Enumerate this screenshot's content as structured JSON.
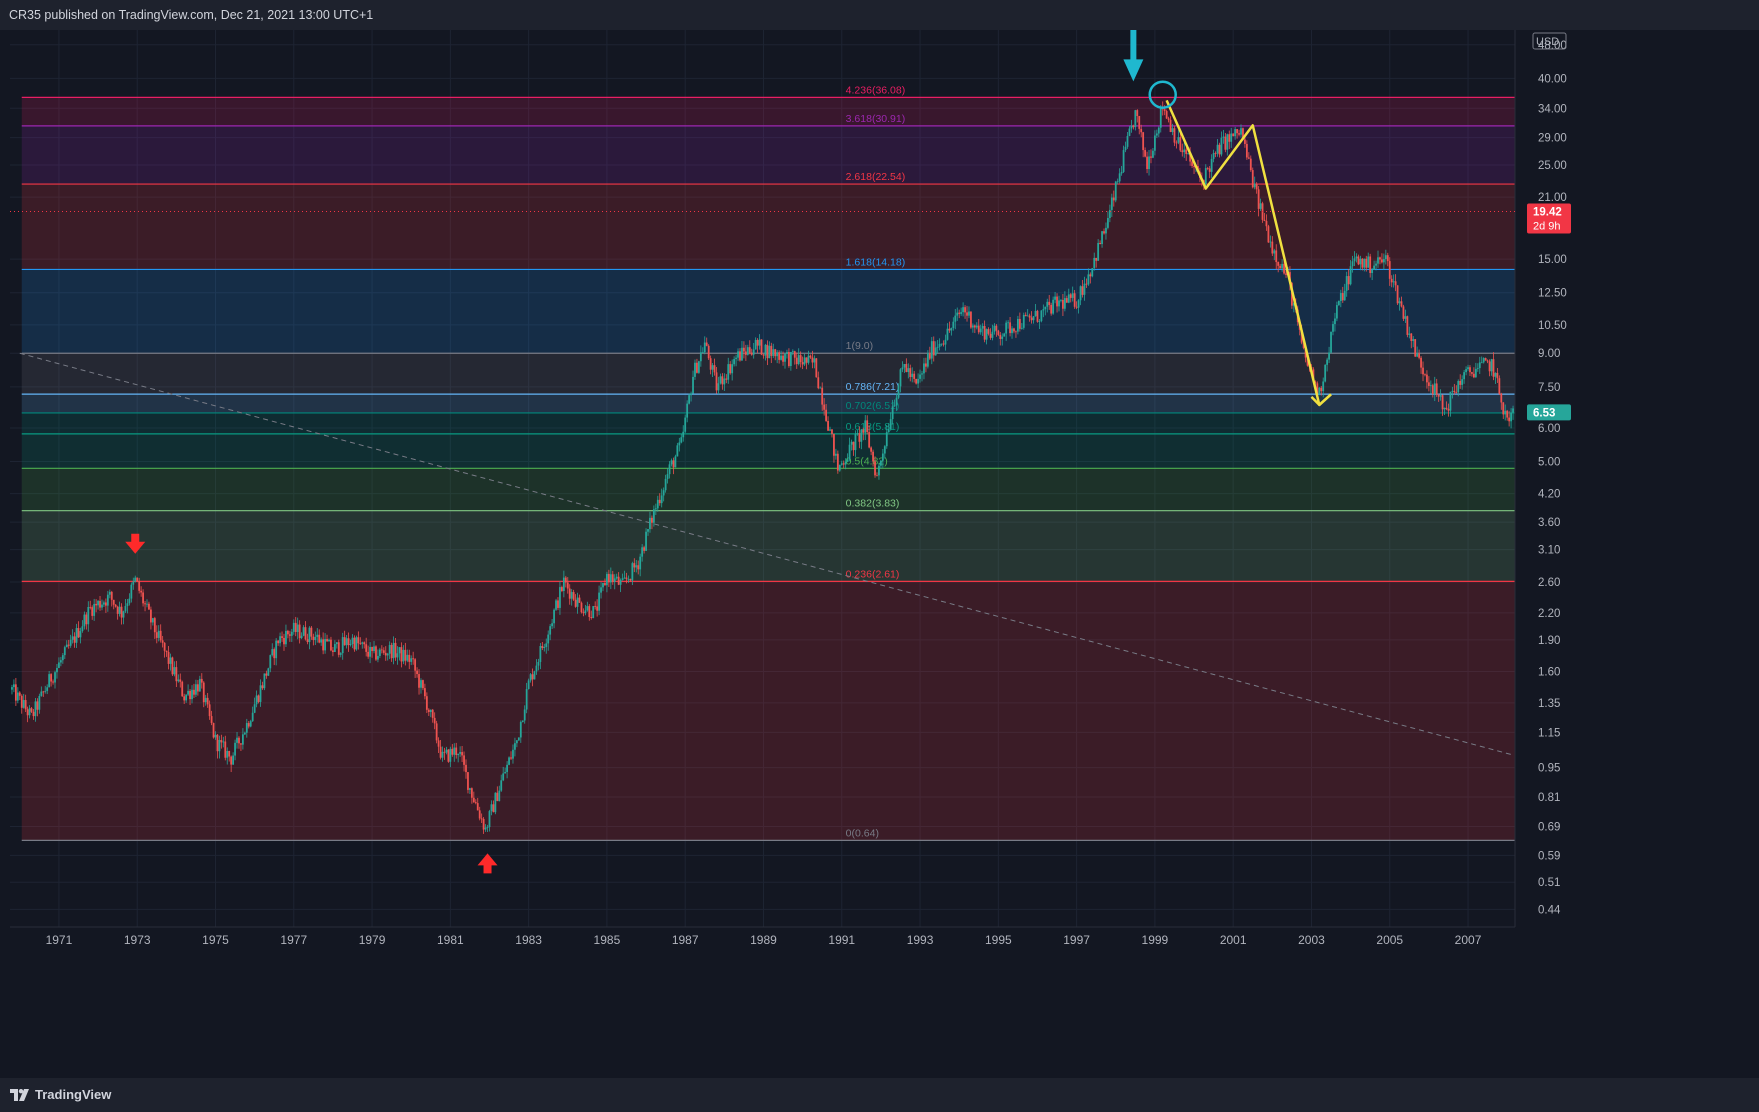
{
  "header": {
    "publish_line": "CR35 published on TradingView.com, Dec 21, 2021 13:00 UTC+1"
  },
  "footer": {
    "brand": "TradingView",
    "logo_icon": "tradingview-logo-icon"
  },
  "colors": {
    "background": "#131722",
    "up": "#26a69a",
    "down": "#ef5350",
    "annotation_line": "#f0e040",
    "arrow_up_down": "#ff2a2a",
    "arrow_top": "#1fb8cf"
  },
  "chart_data": {
    "type": "candlestick",
    "currency": "USD",
    "y_scale": "log",
    "ylim": [
      0.4,
      52
    ],
    "xlim": [
      1969.75,
      2008.2
    ],
    "y_ticks": [
      0.44,
      0.51,
      0.59,
      0.69,
      0.81,
      0.95,
      1.15,
      1.35,
      1.6,
      1.9,
      2.2,
      2.6,
      3.1,
      3.6,
      4.2,
      5.0,
      6.0,
      7.5,
      9.0,
      10.5,
      12.5,
      15.0,
      21.0,
      25.0,
      29.0,
      34.0,
      40.0,
      48.0
    ],
    "y_tick_labels": [
      "0.44",
      "0.51",
      "0.59",
      "0.69",
      "0.81",
      "0.95",
      "1.15",
      "1.35",
      "1.60",
      "1.90",
      "2.20",
      "2.60",
      "3.10",
      "3.60",
      "4.20",
      "5.00",
      "6.00",
      "7.50",
      "9.00",
      "10.50",
      "12.50",
      "15.00",
      "21.00",
      "25.00",
      "29.00",
      "34.00",
      "40.00",
      "48.00"
    ],
    "x_ticks": [
      1971,
      1973,
      1975,
      1977,
      1979,
      1981,
      1983,
      1985,
      1987,
      1989,
      1991,
      1993,
      1995,
      1997,
      1999,
      2001,
      2003,
      2005,
      2007
    ],
    "x_tick_labels": [
      "1971",
      "1973",
      "1975",
      "1977",
      "1979",
      "1981",
      "1983",
      "1985",
      "1987",
      "1989",
      "1991",
      "1993",
      "1995",
      "1997",
      "1999",
      "2001",
      "2003",
      "2005",
      "2007"
    ],
    "price_path": [
      [
        1969.8,
        1.45
      ],
      [
        1970.3,
        1.25
      ],
      [
        1970.8,
        1.55
      ],
      [
        1971.3,
        1.85
      ],
      [
        1971.8,
        2.25
      ],
      [
        1972.3,
        2.4
      ],
      [
        1972.6,
        2.2
      ],
      [
        1972.95,
        2.62
      ],
      [
        1973.4,
        2.05
      ],
      [
        1973.8,
        1.7
      ],
      [
        1974.2,
        1.4
      ],
      [
        1974.6,
        1.5
      ],
      [
        1975.0,
        1.1
      ],
      [
        1975.4,
        1.0
      ],
      [
        1975.8,
        1.2
      ],
      [
        1976.2,
        1.5
      ],
      [
        1976.6,
        1.9
      ],
      [
        1977.0,
        2.0
      ],
      [
        1977.5,
        1.95
      ],
      [
        1978.0,
        1.8
      ],
      [
        1978.5,
        1.9
      ],
      [
        1979.0,
        1.75
      ],
      [
        1979.5,
        1.8
      ],
      [
        1980.0,
        1.7
      ],
      [
        1980.4,
        1.35
      ],
      [
        1980.8,
        1.0
      ],
      [
        1981.2,
        1.05
      ],
      [
        1981.5,
        0.85
      ],
      [
        1981.9,
        0.68
      ],
      [
        1982.3,
        0.88
      ],
      [
        1982.7,
        1.1
      ],
      [
        1983.0,
        1.5
      ],
      [
        1983.5,
        2.0
      ],
      [
        1983.9,
        2.6
      ],
      [
        1984.3,
        2.3
      ],
      [
        1984.7,
        2.2
      ],
      [
        1985.0,
        2.7
      ],
      [
        1985.4,
        2.55
      ],
      [
        1985.8,
        2.9
      ],
      [
        1986.2,
        3.8
      ],
      [
        1986.6,
        4.8
      ],
      [
        1986.9,
        5.5
      ],
      [
        1987.2,
        8.0
      ],
      [
        1987.5,
        9.5
      ],
      [
        1987.8,
        7.5
      ],
      [
        1988.3,
        8.8
      ],
      [
        1988.8,
        9.4
      ],
      [
        1989.3,
        9.0
      ],
      [
        1989.8,
        8.7
      ],
      [
        1990.3,
        8.5
      ],
      [
        1990.6,
        6.5
      ],
      [
        1990.9,
        4.8
      ],
      [
        1991.3,
        5.5
      ],
      [
        1991.6,
        6.0
      ],
      [
        1991.9,
        4.6
      ],
      [
        1992.3,
        6.8
      ],
      [
        1992.6,
        8.5
      ],
      [
        1992.9,
        7.5
      ],
      [
        1993.3,
        9.2
      ],
      [
        1993.7,
        10.0
      ],
      [
        1994.1,
        11.5
      ],
      [
        1994.5,
        10.2
      ],
      [
        1995.0,
        10.0
      ],
      [
        1995.5,
        10.6
      ],
      [
        1996.0,
        11.0
      ],
      [
        1996.5,
        11.8
      ],
      [
        1997.0,
        12.0
      ],
      [
        1997.4,
        14.5
      ],
      [
        1997.8,
        18.5
      ],
      [
        1998.2,
        26.0
      ],
      [
        1998.5,
        33.0
      ],
      [
        1998.8,
        25.0
      ],
      [
        1999.2,
        34.5
      ],
      [
        1999.6,
        28.0
      ],
      [
        2000.2,
        23.0
      ],
      [
        2000.7,
        28.0
      ],
      [
        2001.2,
        30.0
      ],
      [
        2001.6,
        21.0
      ],
      [
        2002.0,
        16.0
      ],
      [
        2002.4,
        13.5
      ],
      [
        2002.8,
        9.0
      ],
      [
        2003.2,
        7.2
      ],
      [
        2003.6,
        11.0
      ],
      [
        2004.1,
        15.0
      ],
      [
        2004.5,
        14.5
      ],
      [
        2004.9,
        15.0
      ],
      [
        2005.3,
        11.5
      ],
      [
        2005.7,
        8.8
      ],
      [
        2006.1,
        7.5
      ],
      [
        2006.4,
        6.6
      ],
      [
        2006.8,
        7.8
      ],
      [
        2007.2,
        8.3
      ],
      [
        2007.6,
        8.5
      ],
      [
        2008.0,
        6.2
      ],
      [
        2008.15,
        6.53
      ]
    ],
    "fibonacci": [
      {
        "ratio": 0,
        "value": 0.64,
        "label": "0(0.64)",
        "color": "#787b86"
      },
      {
        "ratio": 0.236,
        "value": 2.61,
        "label": "0.236(2.61)",
        "color": "#f23645"
      },
      {
        "ratio": 0.382,
        "value": 3.83,
        "label": "0.382(3.83)",
        "color": "#81c784"
      },
      {
        "ratio": 0.5,
        "value": 4.82,
        "label": "0.5(4.82)",
        "color": "#4caf50"
      },
      {
        "ratio": 0.618,
        "value": 5.81,
        "label": "0.618(5.81)",
        "color": "#089981"
      },
      {
        "ratio": 0.702,
        "value": 6.51,
        "label": "0.702(6.51)",
        "color": "#00897b"
      },
      {
        "ratio": 0.786,
        "value": 7.21,
        "label": "0.786(7.21)",
        "color": "#64b5f6"
      },
      {
        "ratio": 1,
        "value": 9.0,
        "label": "1(9.0)",
        "color": "#787b86"
      },
      {
        "ratio": 1.618,
        "value": 14.18,
        "label": "1.618(14.18)",
        "color": "#2196f3"
      },
      {
        "ratio": 2.618,
        "value": 22.54,
        "label": "2.618(22.54)",
        "color": "#f23645"
      },
      {
        "ratio": 3.618,
        "value": 30.91,
        "label": "3.618(30.91)",
        "color": "#9c27b0"
      },
      {
        "ratio": 4.236,
        "value": 36.08,
        "label": "4.236(36.08)",
        "color": "#e91e63"
      }
    ],
    "price_labels": [
      {
        "value": 19.42,
        "label": "19.42",
        "sublabel": "2d 9h",
        "color": "#f23645",
        "dotted_line": true
      },
      {
        "value": 6.53,
        "label": "6.53",
        "color": "#26a69a"
      }
    ],
    "trendline": [
      [
        1970.0,
        9.0
      ],
      [
        2008.1,
        1.02
      ]
    ],
    "annotation_path": [
      [
        1999.3,
        35.5
      ],
      [
        2000.3,
        22.0
      ],
      [
        2001.5,
        31.0
      ],
      [
        2003.2,
        6.8
      ],
      [
        2003.5,
        7.2
      ]
    ],
    "annotation_arrowhead": [
      [
        2003.0,
        7.1
      ],
      [
        2003.2,
        6.8
      ],
      [
        2003.5,
        7.2
      ]
    ],
    "markers": [
      {
        "name": "top-arrow",
        "x": 1998.45,
        "y": 42.0,
        "dir": "down",
        "color": "#1fb8cf",
        "big": true
      },
      {
        "name": "top-circle",
        "x": 1999.2,
        "y": 36.6,
        "color": "#1fb8cf"
      },
      {
        "name": "high-arrow-1973",
        "x": 1972.95,
        "y": 3.2,
        "dir": "down",
        "color": "#ff2a2a"
      },
      {
        "name": "low-arrow-1981",
        "x": 1981.95,
        "y": 0.565,
        "dir": "up",
        "color": "#ff2a2a"
      }
    ]
  }
}
